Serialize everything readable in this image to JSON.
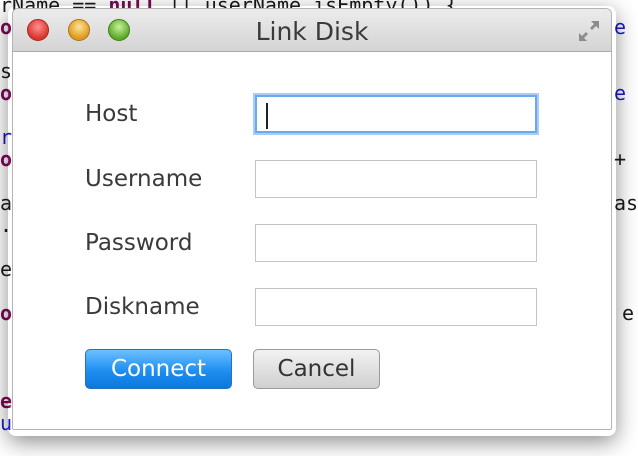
{
  "background_code": {
    "line1_prefix": "rName == ",
    "line1_kw": "null",
    "line1_rest": " || userName.isEmpty()) {",
    "fragments_left": [
      "o",
      "s",
      "o",
      "r",
      "o",
      "a",
      ".",
      "e",
      "o",
      "e",
      "u"
    ],
    "fragments_right": [
      "e",
      "e",
      "+ (",
      "as",
      "e"
    ]
  },
  "window": {
    "title": "Link Disk",
    "controls": [
      "close",
      "minimize",
      "zoom"
    ],
    "fullscreen_icon": "fullscreen-arrows-icon"
  },
  "form": {
    "host_label": "Host",
    "host_value": "",
    "username_label": "Username",
    "username_value": "",
    "password_label": "Password",
    "password_value": "",
    "diskname_label": "Diskname",
    "diskname_value": ""
  },
  "buttons": {
    "connect_label": "Connect",
    "cancel_label": "Cancel"
  },
  "colors": {
    "connect_blue": "#1e8ef0",
    "focus_ring": "#6aa9ef",
    "keyword_purple": "#7a0a55",
    "code_blue": "#1a1acc"
  }
}
